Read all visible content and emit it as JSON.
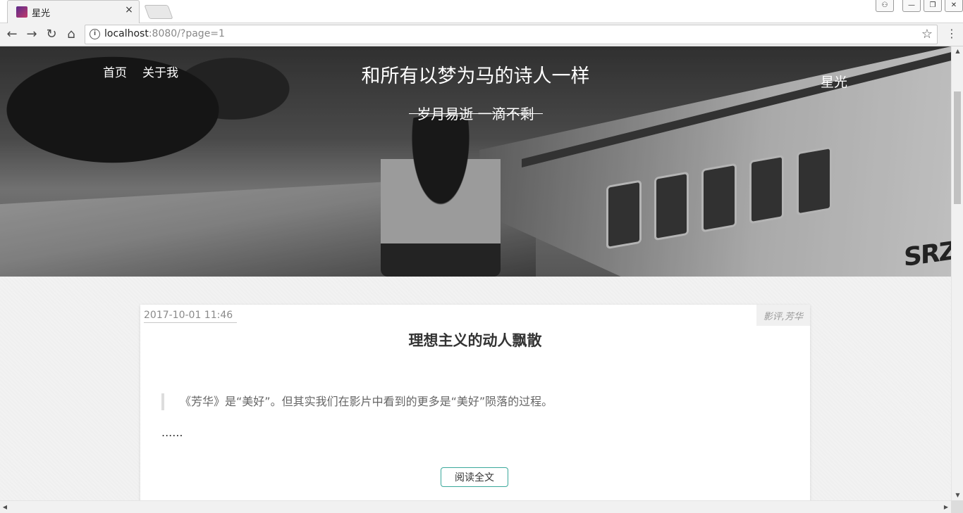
{
  "browser": {
    "tab_title": "星光",
    "tab_close": "×",
    "url_host": "localhost",
    "url_rest": ":8080/?page=1",
    "window_buttons": {
      "user": "⚇",
      "minimize": "—",
      "restore": "❐",
      "close": "✕"
    }
  },
  "nav": {
    "back": "←",
    "forward": "→",
    "reload": "↻",
    "home": "⌂",
    "info": "i",
    "star": "☆",
    "menu": "⋮"
  },
  "site": {
    "nav_items": [
      "首页",
      "关于我"
    ],
    "title": "和所有以梦为马的诗人一样",
    "subtitle": "岁月易逝 一滴不剩",
    "brand": "星光",
    "hero_image_text": "SRZ"
  },
  "post": {
    "date": "2017-10-01 11:46",
    "tags": "影评,芳华",
    "title": "理想主义的动人飘散",
    "quote": "《芳华》是“美好”。但其实我们在影片中看到的更多是“美好”陨落的过程。",
    "ellipsis": "......",
    "read_more": "阅读全文"
  },
  "scrollbar": {
    "up": "▲",
    "down": "▼",
    "left": "◀",
    "right": "▶"
  },
  "icons": {
    "favicon": "favicon-icon",
    "back": "back-arrow-icon",
    "forward": "forward-arrow-icon",
    "reload": "reload-icon",
    "home": "home-icon",
    "info": "info-icon",
    "star": "star-icon",
    "menu": "menu-icon"
  }
}
